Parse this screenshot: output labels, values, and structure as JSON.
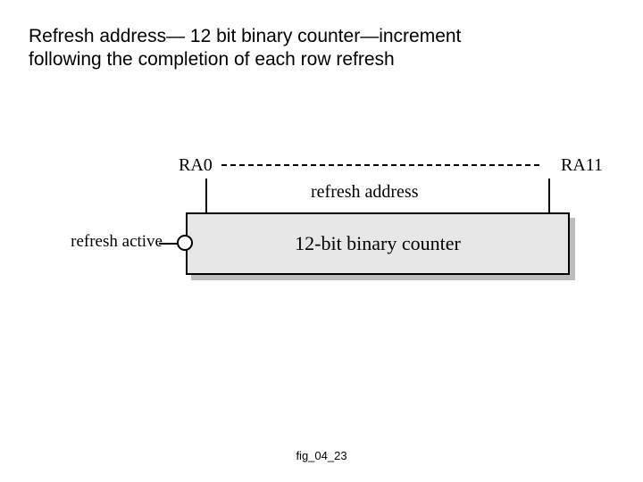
{
  "title": "Refresh address— 12 bit binary counter—increment following the completion of each row refresh",
  "diagram": {
    "ra_left": "RA0",
    "ra_right": "RA11",
    "refresh_address_label": "refresh address",
    "counter_label": "12-bit binary counter",
    "refresh_active_label": "refresh active"
  },
  "figure_id": "fig_04_23"
}
